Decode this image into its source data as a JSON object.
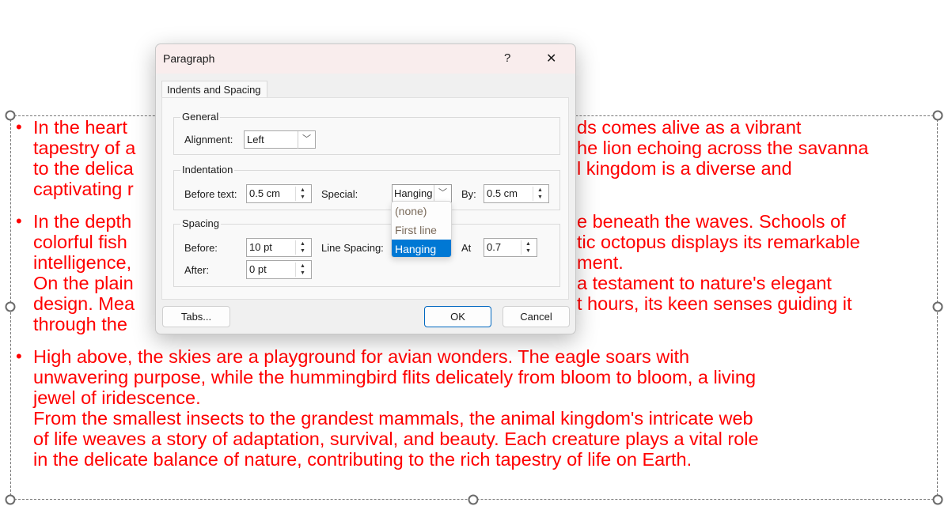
{
  "slide": {
    "text_color": "#ff0000",
    "paragraphs": [
      {
        "lines": [
          {
            "left": "In the heart",
            "right": "ds comes alive as a vibrant"
          },
          {
            "left": "tapestry of a",
            "right": "he lion echoing across the savanna"
          },
          {
            "left": "to the delica",
            "right": "l kingdom is a diverse and"
          },
          {
            "left": "captivating r",
            "right": ""
          }
        ]
      },
      {
        "lines": [
          {
            "left": "In the depth",
            "right": "e beneath the waves. Schools of"
          },
          {
            "left": "colorful fish",
            "right": "tic octopus displays its remarkable"
          },
          {
            "left": "intelligence,",
            "right": "ment."
          },
          {
            "left": "On the plain",
            "right": "a testament to nature's elegant"
          },
          {
            "left": "design. Mea",
            "right": "t hours, its keen senses guiding it"
          },
          {
            "left": "through the",
            "right": ""
          }
        ]
      },
      {
        "lines": [
          {
            "left": "High above, the skies are a playground for avian wonders. The eagle soars with",
            "right": ""
          },
          {
            "left": "unwavering purpose, while the hummingbird flits delicately from bloom to bloom, a living",
            "right": ""
          },
          {
            "left": "jewel of iridescence.",
            "right": ""
          },
          {
            "left": "From the smallest insects to the grandest mammals, the animal kingdom's intricate web",
            "right": ""
          },
          {
            "left": "of life weaves a story of adaptation, survival, and beauty. Each creature plays a vital role",
            "right": ""
          },
          {
            "left": "in the delicate balance of nature, contributing to the rich tapestry of life on Earth.",
            "right": ""
          }
        ]
      }
    ],
    "bullet": "•"
  },
  "dialog": {
    "title": "Paragraph",
    "help": "?",
    "close": "✕",
    "tab": "Indents and Spacing",
    "general": {
      "label": "General",
      "alignment_label": "Alignment:",
      "alignment_value": "Left"
    },
    "indentation": {
      "label": "Indentation",
      "before_text_label": "Before text:",
      "before_text_value": "0.5 cm",
      "special_label": "Special:",
      "special_value": "Hanging",
      "by_label": "By:",
      "by_value": "0.5 cm"
    },
    "special_options": [
      "(none)",
      "First line",
      "Hanging"
    ],
    "special_selected": "Hanging",
    "spacing": {
      "label": "Spacing",
      "before_label": "Before:",
      "before_value": "10 pt",
      "after_label": "After:",
      "after_value": "0 pt",
      "line_spacing_label": "Line Spacing:",
      "at_label": "At",
      "at_value": "0.7"
    },
    "buttons": {
      "tabs": "Tabs...",
      "ok": "OK",
      "cancel": "Cancel"
    },
    "accent": "#0078d4"
  }
}
